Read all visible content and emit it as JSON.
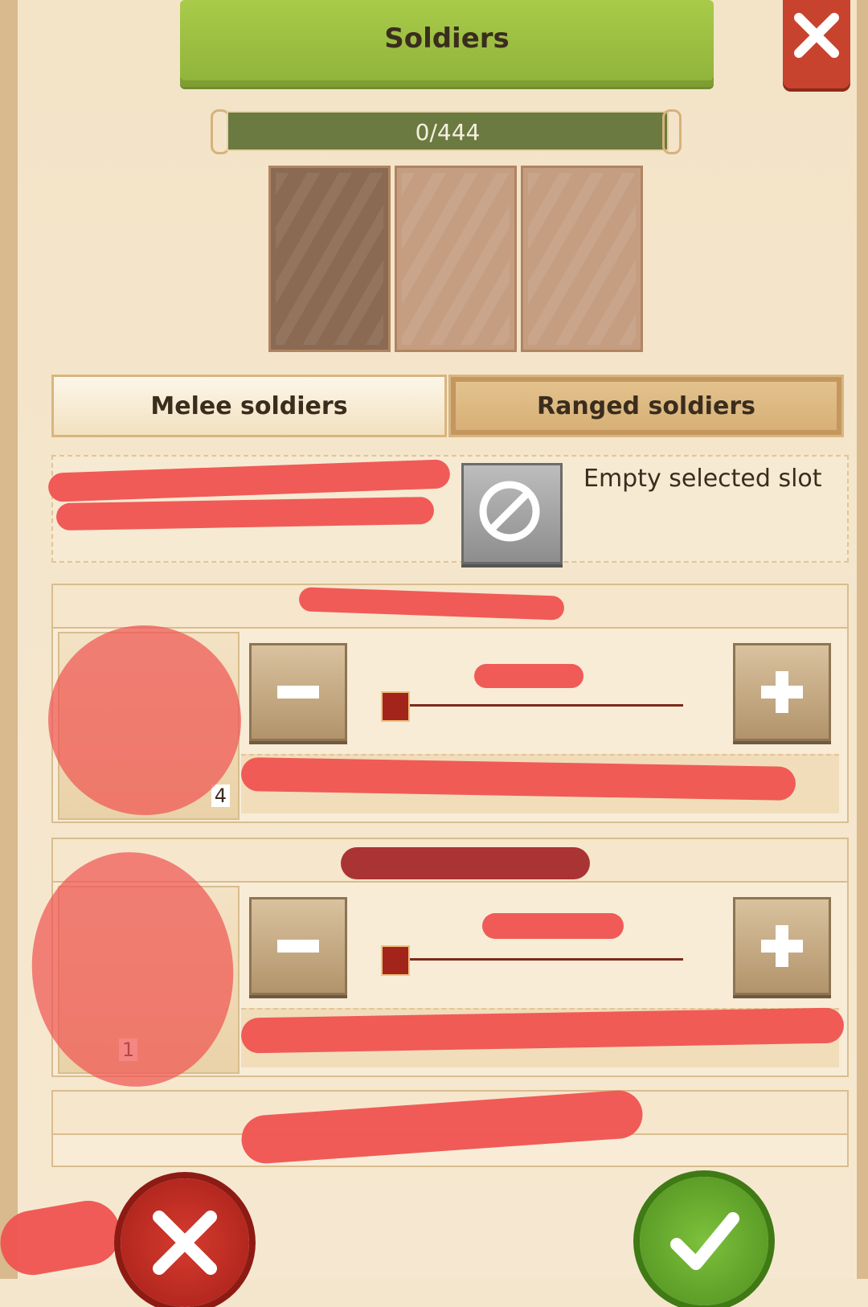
{
  "header": {
    "title": "Soldiers"
  },
  "capacity": {
    "text": "0/444",
    "fraction": 0
  },
  "slots": [
    {
      "state": "selected"
    },
    {
      "state": "empty"
    },
    {
      "state": "empty"
    }
  ],
  "tabs": [
    {
      "label": "Melee soldiers",
      "selected": false
    },
    {
      "label": "Ranged soldiers",
      "selected": true
    }
  ],
  "empty_slot": {
    "label": "Empty selected slot"
  },
  "units": [
    {
      "portrait_count": "4"
    },
    {
      "portrait_count": "1"
    }
  ],
  "colors": {
    "title_banner": "#98bb41",
    "close": "#c8432e",
    "cancel": "#c32d23",
    "confirm": "#5fa428",
    "progress": "#6b7a40",
    "selected_tab": "#dcb882",
    "redaction": "#ef5350"
  },
  "icons": [
    "close-x-icon",
    "no-entry-icon",
    "minus-icon",
    "plus-icon",
    "cancel-x-icon",
    "checkmark-icon"
  ]
}
